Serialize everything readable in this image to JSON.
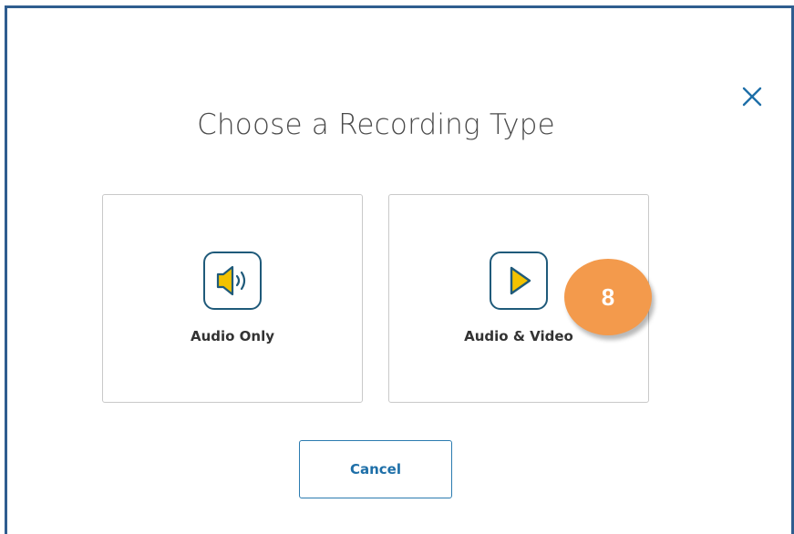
{
  "dialog": {
    "title": "Choose a Recording Type",
    "close_icon": "close-icon",
    "accent_color": "#2f5d8f"
  },
  "options": [
    {
      "label": "Audio Only",
      "icon": "speaker-icon",
      "icon_color": "#f2c200"
    },
    {
      "label": "Audio & Video",
      "icon": "play-icon",
      "icon_color": "#f2c200"
    }
  ],
  "cancel": {
    "label": "Cancel"
  },
  "step_badge": {
    "text": "8",
    "color": "#f39a4c"
  }
}
